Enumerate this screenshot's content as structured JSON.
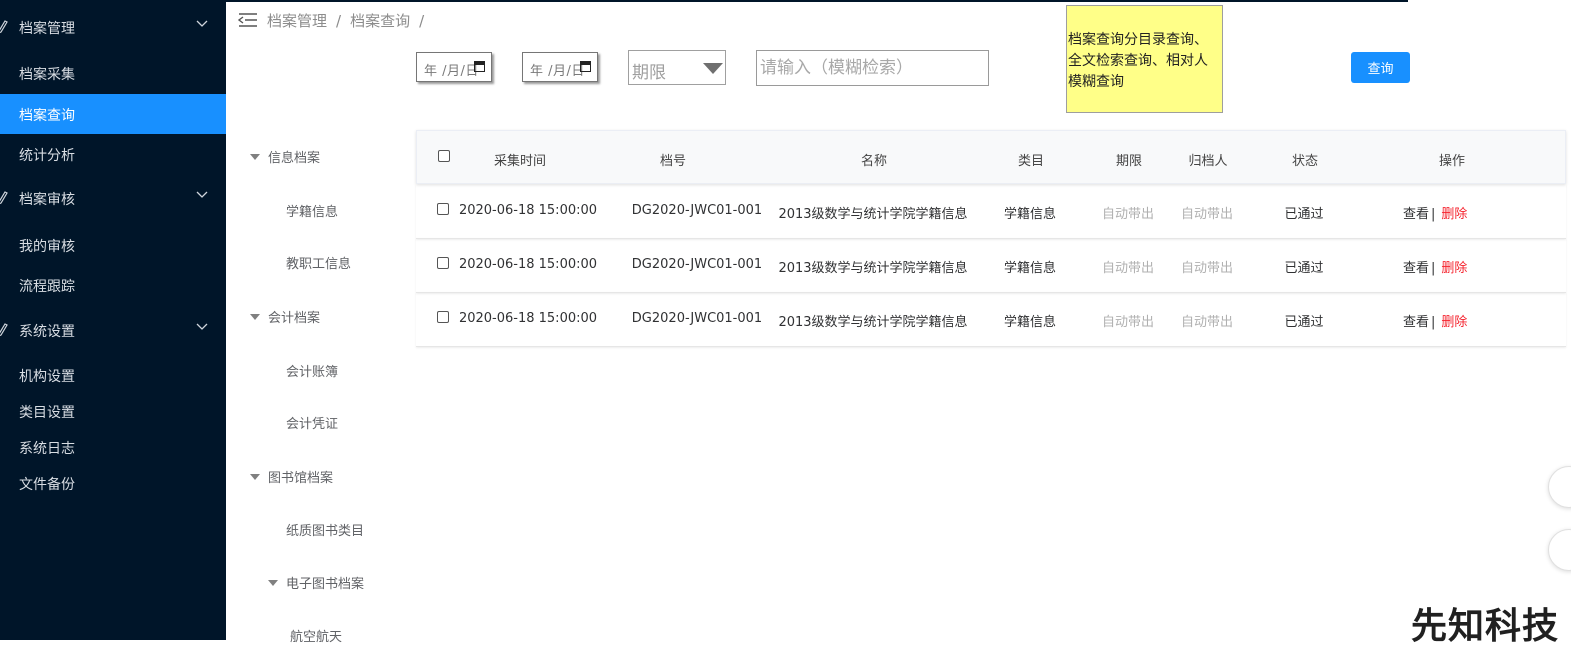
{
  "sidebar": {
    "groups": [
      {
        "label": "档案管理",
        "items": [
          "档案采集",
          "档案查询",
          "统计分析"
        ]
      },
      {
        "label": "档案审核",
        "items": [
          "我的审核",
          "流程跟踪"
        ]
      },
      {
        "label": "系统设置",
        "items": [
          "机构设置",
          "类目设置",
          "系统日志",
          "文件备份"
        ]
      }
    ],
    "active_item": "档案查询"
  },
  "breadcrumb": {
    "level1": "档案管理",
    "separator": "/",
    "level2": "档案查询",
    "trailing": "/"
  },
  "filters": {
    "date_start_placeholder": "年 /月/日",
    "date_end_placeholder": "年 /月/日",
    "period_select": "期限",
    "search_placeholder": "请输入（模糊检索）",
    "query_button": "查询"
  },
  "note": "档案查询分目录查询、全文检索查询、相对人模糊查询",
  "tree": [
    {
      "label": "信息档案",
      "expanded": true
    },
    {
      "label": "学籍信息"
    },
    {
      "label": "教职工信息"
    },
    {
      "label": "会计档案",
      "expanded": true
    },
    {
      "label": "会计账簿"
    },
    {
      "label": "会计凭证"
    },
    {
      "label": "图书馆档案",
      "expanded": true
    },
    {
      "label": "纸质图书类目"
    },
    {
      "label": "电子图书档案",
      "expanded": true
    },
    {
      "label": "航空航天"
    }
  ],
  "table": {
    "headers": [
      "采集时间",
      "档号",
      "名称",
      "类目",
      "期限",
      "归档人",
      "状态",
      "操作"
    ],
    "rows": [
      {
        "time": "2020-06-18 15:00:00",
        "code": "DG2020-JWC01-001",
        "name": "2013级数学与统计学院学籍信息",
        "category": "学籍信息",
        "period": "自动带出",
        "archiver": "自动带出",
        "status": "已通过",
        "view": "查看",
        "sep": "|",
        "delete": "删除"
      },
      {
        "time": "2020-06-18 15:00:00",
        "code": "DG2020-JWC01-001",
        "name": "2013级数学与统计学院学籍信息",
        "category": "学籍信息",
        "period": "自动带出",
        "archiver": "自动带出",
        "status": "已通过",
        "view": "查看",
        "sep": "|",
        "delete": "删除"
      },
      {
        "time": "2020-06-18 15:00:00",
        "code": "DG2020-JWC01-001",
        "name": "2013级数学与统计学院学籍信息",
        "category": "学籍信息",
        "period": "自动带出",
        "archiver": "自动带出",
        "status": "已通过",
        "view": "查看",
        "sep": "|",
        "delete": "删除"
      }
    ]
  },
  "watermark": "先知科技",
  "colors": {
    "sidebar_bg": "#001529",
    "accent": "#1890ff",
    "delete": "#f5222d",
    "note_bg": "#ffff88"
  }
}
